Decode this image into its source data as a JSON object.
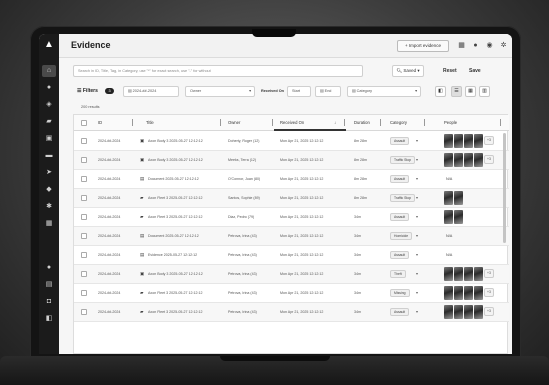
{
  "app": {
    "title": "Evidence",
    "import_label": "+ Import evidence",
    "top_icons": [
      "grid-icon",
      "user-icon",
      "help-icon",
      "settings-icon"
    ]
  },
  "sidebar": {
    "items": [
      "home-icon",
      "dashboard-icon",
      "layers-icon",
      "car-icon",
      "folder-icon",
      "list-icon",
      "send-icon",
      "location-icon",
      "gear-icon",
      "grid-icon"
    ],
    "bottom_items": [
      "help-icon",
      "document-icon",
      "lock-icon",
      "tag-icon"
    ]
  },
  "search": {
    "placeholder": "Search in ID, Title, Tag, in Category, use \"*\" for exact search, use \"-\" for without",
    "saved_label": "Saved",
    "reset_label": "Reset",
    "save_label": "Save"
  },
  "filters": {
    "label": "Filters",
    "count": "3",
    "date_value": "2024-##-2024",
    "owner_placeholder": "Owner",
    "received_on_label": "Received On",
    "start_placeholder": "Start",
    "end_placeholder": "End",
    "category_placeholder": "Category",
    "results": "200 results"
  },
  "table": {
    "headers": [
      "ID",
      "Title",
      "Owner",
      "Received On",
      "Duration",
      "Category",
      "People"
    ],
    "rows": [
      {
        "id": "2024-##-2024",
        "icon": "video-icon",
        "title": "Axon Body 3 2025-05-27 12:12:12",
        "owner": "Doherty, Roger (12)",
        "received": "Mon Apr 21, 2025 12:12:12",
        "duration": "8m 28m",
        "category": "Assault",
        "people_count": 4,
        "more": "+3",
        "na": ""
      },
      {
        "id": "2024-##-2024",
        "icon": "video-icon",
        "title": "Axon Body 3 2025-05-27 12:12:12",
        "owner": "Meeks, Terra (12)",
        "received": "Mon Apr 21, 2025 12:12:12",
        "duration": "8m 28m",
        "category": "Traffic Stop",
        "people_count": 4,
        "more": "+3",
        "na": ""
      },
      {
        "id": "2024-##-2024",
        "icon": "document-icon",
        "title": "Document 2025-05-27 12:12:12",
        "owner": "O'Connor, Juan (80)",
        "received": "Mon Apr 21, 2025 12:12:12",
        "duration": "8m 28m",
        "category": "Assault",
        "people_count": 0,
        "more": "",
        "na": "N/A"
      },
      {
        "id": "2024-##-2024",
        "icon": "car-icon",
        "title": "Axon Fleet 3 2025-05-27 12:12:12",
        "owner": "Santos, Sophie (89)",
        "received": "Mon Apr 21, 2025 12:12:12",
        "duration": "8m 28m",
        "category": "Traffic Stop",
        "people_count": 2,
        "more": "",
        "na": ""
      },
      {
        "id": "2024-##-2024",
        "icon": "car-icon",
        "title": "Axon Fleet 3 2025-05-27 12:12:12",
        "owner": "Diaz, Pedro (79)",
        "received": "Mon Apr 21, 2025 12:12:12",
        "duration": "34m",
        "category": "Assault",
        "people_count": 2,
        "more": "",
        "na": ""
      },
      {
        "id": "2024-##-2024",
        "icon": "document-icon",
        "title": "Document 2025-05-27 12:12:12",
        "owner": "Petrova, Irina (43)",
        "received": "Mon Apr 21, 2025 12:12:12",
        "duration": "34m",
        "category": "Homicide",
        "people_count": 0,
        "more": "",
        "na": "N/A"
      },
      {
        "id": "2024-##-2024",
        "icon": "document-icon",
        "title": "Evidence 2025-05-27 12:12:12",
        "owner": "Petrova, Irina (43)",
        "received": "Mon Apr 21, 2025 12:12:12",
        "duration": "34m",
        "category": "Assault",
        "people_count": 0,
        "more": "",
        "na": "N/A"
      },
      {
        "id": "2024-##-2024",
        "icon": "video-icon",
        "title": "Axon Body 3 2025-05-27 12:12:12",
        "owner": "Petrova, Irina (43)",
        "received": "Mon Apr 21, 2025 12:12:12",
        "duration": "34m",
        "category": "Theft",
        "people_count": 4,
        "more": "+3",
        "na": ""
      },
      {
        "id": "2024-##-2024",
        "icon": "car-icon",
        "title": "Axon Fleet 3 2025-05-27 12:12:12",
        "owner": "Petrova, Irina (43)",
        "received": "Mon Apr 21, 2025 12:12:12",
        "duration": "34m",
        "category": "Missing",
        "people_count": 4,
        "more": "+3",
        "na": ""
      },
      {
        "id": "2024-##-2024",
        "icon": "car-icon",
        "title": "Axon Fleet 3 2025-05-27 12:12:12",
        "owner": "Petrova, Irina (43)",
        "received": "Mon Apr 21, 2025 12:12:12",
        "duration": "34m",
        "category": "Assault",
        "people_count": 4,
        "more": "+3",
        "na": ""
      }
    ]
  }
}
